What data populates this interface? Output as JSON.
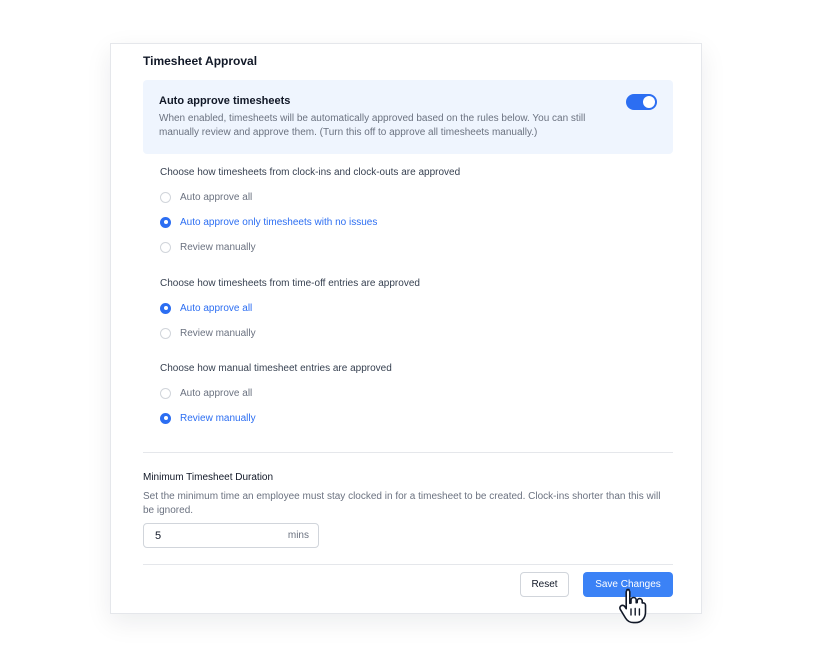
{
  "section": {
    "title": "Timesheet Approval"
  },
  "auto_approve": {
    "title": "Auto approve timesheets",
    "description": "When enabled, timesheets will be automatically approved based on the rules below. You can still manually review and approve them. (Turn this off to approve all timesheets manually.)",
    "enabled": true
  },
  "groups": [
    {
      "title": "Choose how timesheets from clock-ins and clock-outs are approved",
      "options": [
        {
          "label": "Auto approve all",
          "selected": false
        },
        {
          "label": "Auto approve only timesheets with no issues",
          "selected": true
        },
        {
          "label": "Review manually",
          "selected": false
        }
      ]
    },
    {
      "title": "Choose how timesheets from time-off entries are approved",
      "options": [
        {
          "label": "Auto approve all",
          "selected": true
        },
        {
          "label": "Review manually",
          "selected": false
        }
      ]
    },
    {
      "title": "Choose how manual timesheet entries are approved",
      "options": [
        {
          "label": "Auto approve all",
          "selected": false
        },
        {
          "label": "Review manually",
          "selected": true
        }
      ]
    }
  ],
  "duration": {
    "title": "Minimum Timesheet Duration",
    "description": "Set the minimum time an employee must stay clocked in for a timesheet to be created. Clock-ins shorter than this will be ignored.",
    "value": "5",
    "unit": "mins"
  },
  "actions": {
    "reset_label": "Reset",
    "save_label": "Save Changes"
  },
  "colors": {
    "accent": "#2c6ef2",
    "save_button": "#3b82f6",
    "panel_bg": "#eff5fe"
  },
  "icons": {
    "cursor": "hand-pointer-icon"
  }
}
